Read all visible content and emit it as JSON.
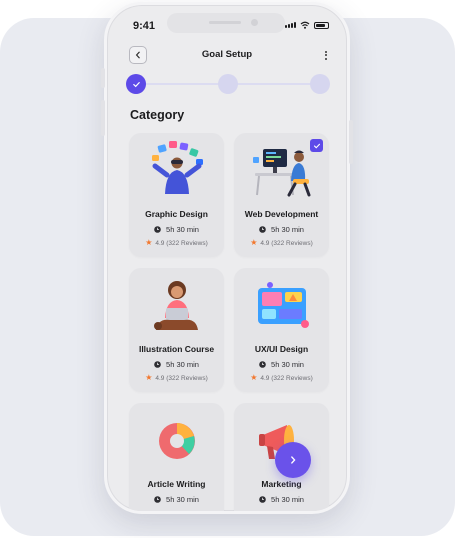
{
  "status_bar": {
    "time": "9:41"
  },
  "header": {
    "title": "Goal Setup",
    "back_icon": "chevron-left-icon",
    "more_icon": "more-vertical-icon"
  },
  "stepper": {
    "steps": [
      {
        "state": "done"
      },
      {
        "state": "pending"
      },
      {
        "state": "pending"
      }
    ]
  },
  "section": {
    "title": "Category"
  },
  "categories": [
    {
      "name": "Graphic Design",
      "duration": "5h 30 min",
      "rating": "4.9 (322 Reviews)",
      "selected": false
    },
    {
      "name": "Web Development",
      "duration": "5h 30 min",
      "rating": "4.9 (322 Reviews)",
      "selected": true
    },
    {
      "name": "Illustration Course",
      "duration": "5h 30 min",
      "rating": "4.9 (322 Reviews)",
      "selected": false
    },
    {
      "name": "UX/UI Design",
      "duration": "5h 30 min",
      "rating": "4.9 (322 Reviews)",
      "selected": false
    },
    {
      "name": "Article Writing",
      "duration": "5h 30 min",
      "rating": "",
      "selected": false
    },
    {
      "name": "Marketing",
      "duration": "5h 30 min",
      "rating": "",
      "selected": false
    }
  ],
  "fab": {
    "icon": "chevron-right-icon"
  },
  "colors": {
    "accent": "#5d4ae8",
    "star": "#f2772e",
    "card_bg": "#e4e4e7",
    "screen_bg": "#ececee",
    "backdrop": "#e9ebf1"
  }
}
